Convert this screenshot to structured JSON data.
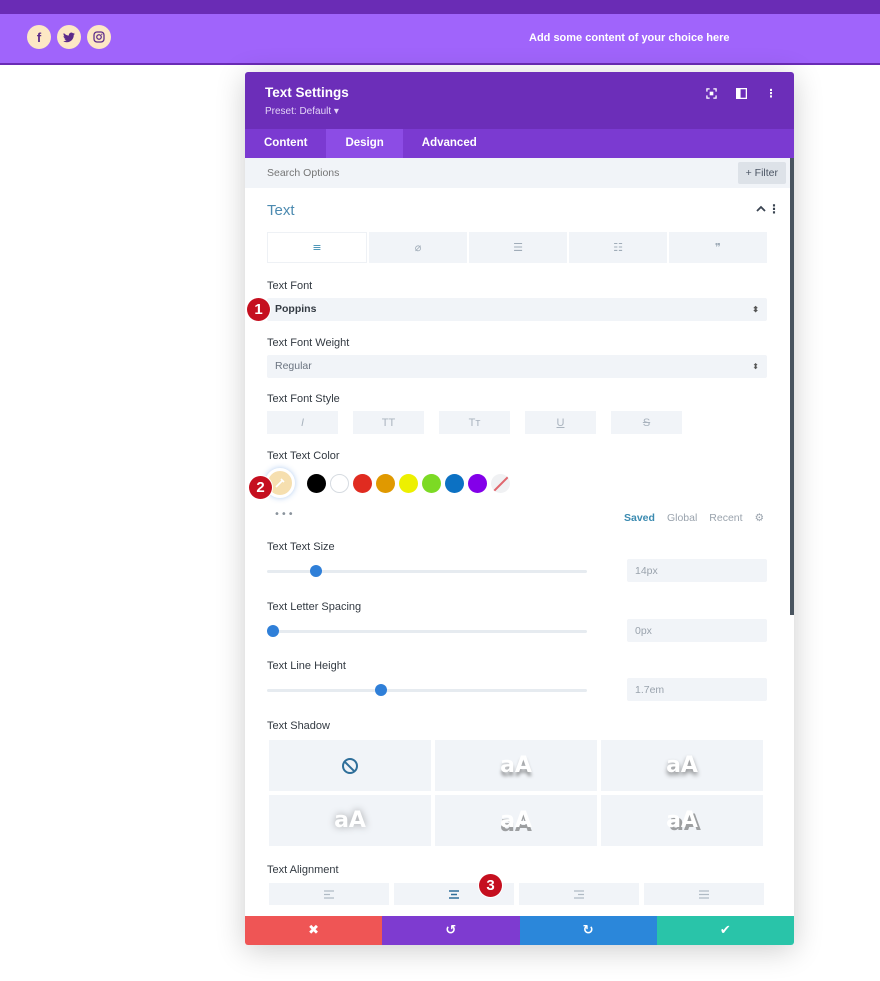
{
  "site": {
    "social": [
      {
        "name": "facebook",
        "glyph": "f"
      },
      {
        "name": "twitter",
        "glyph": "🐦"
      },
      {
        "name": "instagram",
        "glyph": "◎"
      }
    ],
    "header_text": "Add some content of your choice here",
    "colors": {
      "topbar": "#6a2cb5",
      "header": "#a064fb",
      "social_bg": "#fde8c5"
    }
  },
  "modal": {
    "title": "Text Settings",
    "preset": "Preset: Default ▾",
    "header_icons": {
      "focus": "⛶",
      "sidebar": "◫",
      "menu": "⋮"
    },
    "tabs": [
      {
        "label": "Content",
        "active": false
      },
      {
        "label": "Design",
        "active": true
      },
      {
        "label": "Advanced",
        "active": false
      }
    ],
    "search": {
      "placeholder": "Search Options",
      "value": ""
    },
    "filter_label": "+ Filter",
    "section": {
      "title": "Text",
      "chevron": "⌃",
      "menu": "⋮",
      "subtabs": [
        {
          "name": "paragraph",
          "glyph": "≡",
          "active": true
        },
        {
          "name": "link",
          "glyph": "⌀",
          "active": false
        },
        {
          "name": "unordered-list",
          "glyph": "☰",
          "active": false
        },
        {
          "name": "ordered-list",
          "glyph": "☷",
          "active": false
        },
        {
          "name": "quote",
          "glyph": "❞",
          "active": false
        }
      ]
    },
    "fields": {
      "font": {
        "label": "Text Font",
        "value": "Poppins"
      },
      "font_weight": {
        "label": "Text Font Weight",
        "value": "Regular"
      },
      "font_style": {
        "label": "Text Font Style",
        "options": [
          {
            "name": "italic",
            "glyph": "I"
          },
          {
            "name": "uppercase",
            "glyph": "TT"
          },
          {
            "name": "capitalize",
            "glyph": "Tт"
          },
          {
            "name": "underline",
            "glyph": "U"
          },
          {
            "name": "strikethrough",
            "glyph": "S"
          }
        ]
      },
      "text_color": {
        "label": "Text Text Color",
        "current": "#f6dfaf",
        "swatches": [
          "#000000",
          "#ffffff",
          "#e02b20",
          "#e09900",
          "#edf000",
          "#7cda24",
          "#0c71c3",
          "#8300e9"
        ],
        "more": "•••",
        "palette_tabs": [
          {
            "label": "Saved",
            "active": true
          },
          {
            "label": "Global",
            "active": false
          },
          {
            "label": "Recent",
            "active": false
          }
        ],
        "gear": "⚙"
      },
      "text_size": {
        "label": "Text Text Size",
        "value": "14px",
        "slider_fraction": 0.14
      },
      "letter_spacing": {
        "label": "Text Letter Spacing",
        "value": "0px",
        "slider_fraction": 0.0
      },
      "line_height": {
        "label": "Text Line Height",
        "value": "1.7em",
        "slider_fraction": 0.35
      },
      "text_shadow": {
        "label": "Text Shadow",
        "preview_text": "aA",
        "selected": "none"
      },
      "alignment": {
        "label": "Text Alignment",
        "selected": "center",
        "options": [
          "left",
          "center",
          "right",
          "justify"
        ]
      }
    },
    "badges": [
      "1",
      "2",
      "3"
    ],
    "footer": {
      "cancel": "✖",
      "undo": "↺",
      "redo": "↻",
      "save": "✔"
    }
  }
}
